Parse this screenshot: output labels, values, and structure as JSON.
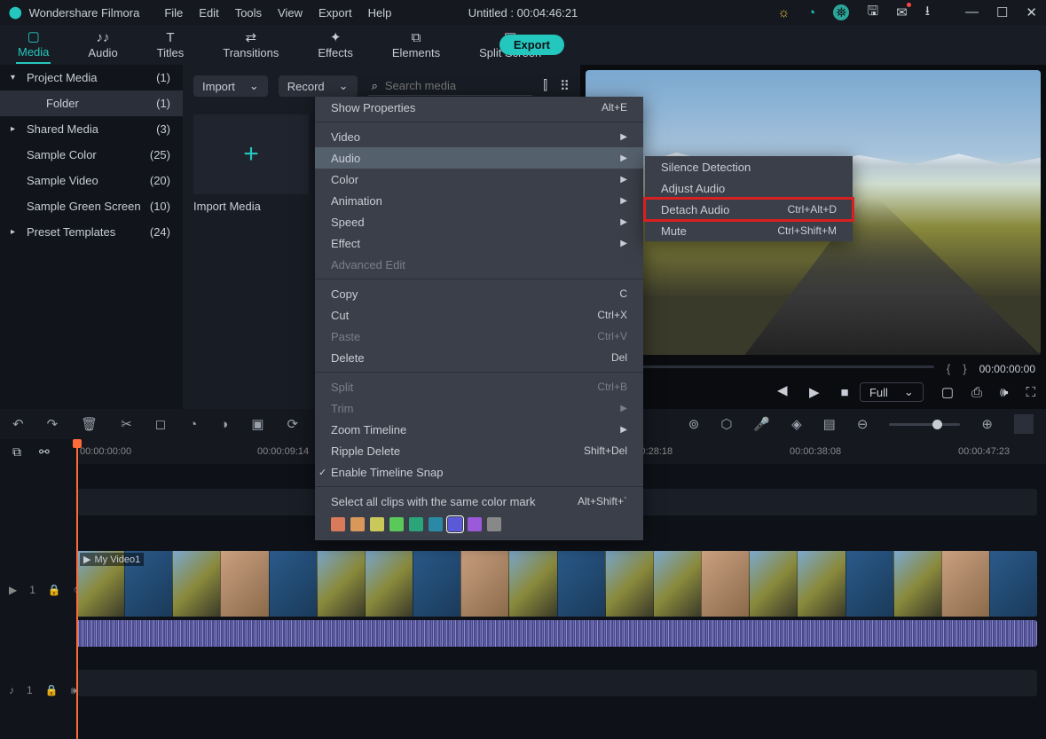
{
  "app": {
    "name": "Wondershare Filmora",
    "title": "Untitled : 00:04:46:21"
  },
  "menubar": [
    "File",
    "Edit",
    "Tools",
    "View",
    "Export",
    "Help"
  ],
  "tabs": [
    {
      "label": "Media",
      "icon": "▢"
    },
    {
      "label": "Audio",
      "icon": "♪♪"
    },
    {
      "label": "Titles",
      "icon": "T"
    },
    {
      "label": "Transitions",
      "icon": "⇄"
    },
    {
      "label": "Effects",
      "icon": "✦"
    },
    {
      "label": "Elements",
      "icon": "⧉"
    },
    {
      "label": "Split Screen",
      "icon": "▣"
    }
  ],
  "export_label": "Export",
  "sidebar": {
    "items": [
      {
        "label": "Project Media",
        "count": "(1)",
        "arrow": "▾"
      },
      {
        "label": "Folder",
        "count": "(1)",
        "selected": true
      },
      {
        "label": "Shared Media",
        "count": "(3)",
        "arrow": "▸"
      },
      {
        "label": "Sample Color",
        "count": "(25)"
      },
      {
        "label": "Sample Video",
        "count": "(20)"
      },
      {
        "label": "Sample Green Screen",
        "count": "(10)"
      },
      {
        "label": "Preset Templates",
        "count": "(24)",
        "arrow": "▸"
      }
    ]
  },
  "media_panel": {
    "import_label": "Import",
    "record_label": "Record",
    "search_placeholder": "Search media",
    "tile_label": "Import Media"
  },
  "preview": {
    "timecode": "00:00:00:00",
    "brace_open": "{",
    "brace_close": "}",
    "quality": "Full"
  },
  "timeline": {
    "ticks": [
      "00:00:00:00",
      "00:00:09:14",
      "00:00:28:18",
      "00:00:38:08",
      "00:00:47:23"
    ],
    "clip_title": "My Video1",
    "video_track_label": "1",
    "audio_track_label": "1"
  },
  "context_menu": {
    "items": [
      {
        "label": "Show Properties",
        "shortcut": "Alt+E"
      },
      {
        "sep": true
      },
      {
        "label": "Video",
        "submenu": true
      },
      {
        "label": "Audio",
        "submenu": true,
        "highlight": true
      },
      {
        "label": "Color",
        "submenu": true
      },
      {
        "label": "Animation",
        "submenu": true
      },
      {
        "label": "Speed",
        "submenu": true
      },
      {
        "label": "Effect",
        "submenu": true
      },
      {
        "label": "Advanced Edit",
        "disabled": true
      },
      {
        "sep": true
      },
      {
        "label": "Copy",
        "shortcut": "C"
      },
      {
        "label": "Cut",
        "shortcut": "Ctrl+X"
      },
      {
        "label": "Paste",
        "shortcut": "Ctrl+V",
        "disabled": true
      },
      {
        "label": "Delete",
        "shortcut": "Del"
      },
      {
        "sep": true
      },
      {
        "label": "Split",
        "shortcut": "Ctrl+B",
        "disabled": true
      },
      {
        "label": "Trim",
        "submenu": true,
        "disabled": true
      },
      {
        "label": "Zoom Timeline",
        "submenu": true
      },
      {
        "label": "Ripple Delete",
        "shortcut": "Shift+Del"
      },
      {
        "label": "Enable Timeline Snap",
        "checked": true
      },
      {
        "sep": true
      },
      {
        "label": "Select all clips with the same color mark",
        "shortcut": "Alt+Shift+`"
      }
    ],
    "swatches": [
      "#d97a5a",
      "#d9985a",
      "#c9c95a",
      "#5ac95a",
      "#2aa57a",
      "#2a8aa5",
      "#5a5ad9",
      "#9a5ad9",
      "#888"
    ]
  },
  "submenu": {
    "items": [
      {
        "label": "Silence Detection"
      },
      {
        "label": "Adjust Audio"
      },
      {
        "label": "Detach Audio",
        "shortcut": "Ctrl+Alt+D",
        "redbox": true
      },
      {
        "label": "Mute",
        "shortcut": "Ctrl+Shift+M"
      }
    ]
  }
}
